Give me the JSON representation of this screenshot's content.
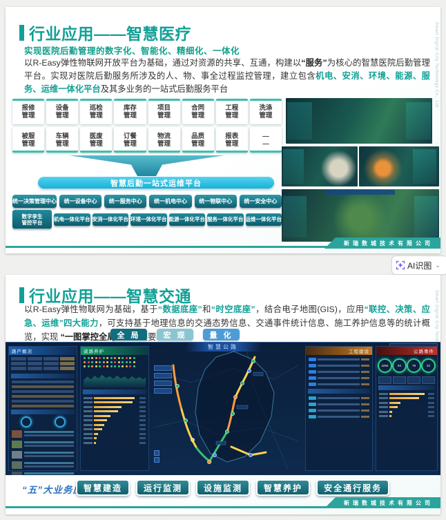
{
  "ai_button": {
    "label": "AI识图",
    "chevron": "⌄"
  },
  "slide1": {
    "title": "行业应用——智慧医疗",
    "side_text": "Smart Digital City Technology Co., Ltd",
    "subtitle": "实现医院后勤管理的数字化、智能化、精细化、一体化",
    "paragraph": [
      {
        "text": "以R-Easy弹性物联网开放平台为基础，通过对资源的共享、互通，构建以",
        "style": "n"
      },
      {
        "text": "“服务”",
        "style": "b"
      },
      {
        "text": "为核心的智慧医院后勤管理平台。实现对医院后勤服务所涉及的人、物、事全过程监控管理，建立包含",
        "style": "n"
      },
      {
        "text": "机电、安消、环境、能源、服务、运维一体化平台",
        "style": "t"
      },
      {
        "text": "及其多业务的一站式后勤服务平台",
        "style": "n"
      }
    ],
    "modules": [
      [
        [
          "报修",
          "管理"
        ],
        [
          "设备",
          "管理"
        ],
        [
          "巡检",
          "管理"
        ],
        [
          "库存",
          "管理"
        ],
        [
          "项目",
          "管理"
        ],
        [
          "合同",
          "管理"
        ],
        [
          "工程",
          "管理"
        ],
        [
          "洗涤",
          "管理"
        ]
      ],
      [
        [
          "被服",
          "管理"
        ],
        [
          "车辆",
          "管理"
        ],
        [
          "医废",
          "管理"
        ],
        [
          "订餐",
          "管理"
        ],
        [
          "物流",
          "管理"
        ],
        [
          "品质",
          "管理"
        ],
        [
          "报表",
          "管理"
        ],
        [
          "—",
          "—"
        ]
      ]
    ],
    "pipeline_bar": "智慧后勤一站式运维平台",
    "centers": [
      "统一决策管理中心",
      "统一设备中心",
      "统一服务中心",
      "统一机电中心",
      "统一物联中心",
      "统一安全中心"
    ],
    "platforms": [
      {
        "lines": [
          "数字孪生",
          "管控平台"
        ]
      },
      {
        "lines": [
          "机电一体化平台"
        ]
      },
      {
        "lines": [
          "安消一体化平台"
        ]
      },
      {
        "lines": [
          "环境一体化平台"
        ]
      },
      {
        "lines": [
          "能源一体化平台"
        ]
      },
      {
        "lines": [
          "服务一体化平台"
        ]
      },
      {
        "lines": [
          "运维一体化平台"
        ]
      }
    ],
    "company": "新瑞数城技术有限公司"
  },
  "slide2": {
    "title": "行业应用——智慧交通",
    "side_text": "Smart Digital City Technology Co., Ltd",
    "paragraph": [
      {
        "text": "以R-Easy弹性物联网为基础，基于",
        "style": "n"
      },
      {
        "text": "“数据底座”",
        "style": "t"
      },
      {
        "text": "和",
        "style": "n"
      },
      {
        "text": "“时空底座”",
        "style": "t"
      },
      {
        "text": "，结合电子地图(GIS)，应用",
        "style": "n"
      },
      {
        "text": "“联控、决策、应急、运维”四大能力",
        "style": "t"
      },
      {
        "text": "，可支持基于地理信息的交通态势信息、交通事件统计信息、施工养护信息等的统计概览，实现 ",
        "style": "n"
      },
      {
        "text": "“一图掌控全局”",
        "style": "b"
      },
      {
        "text": " 的管理要求。",
        "style": "n"
      }
    ],
    "mode_buttons": [
      {
        "label": "全 局",
        "color": "#116e80"
      },
      {
        "label": "宏 观",
        "color": "#8ac6d1"
      },
      {
        "label": "量 化",
        "color": "#4e9cd6"
      }
    ],
    "dashboard": {
      "banner": "智慧公路",
      "panel_titles": {
        "left": "路产概况",
        "maintenance": "道路养护",
        "construction": "工程建设",
        "events": "公路事件"
      },
      "gauge_values": [
        "4284",
        "94",
        "78",
        "22"
      ],
      "maintenance_bars": [
        92,
        88,
        62,
        55,
        38,
        30,
        24,
        18,
        10,
        7,
        5
      ],
      "event_bars": [
        95,
        80,
        30,
        22,
        8,
        5
      ]
    },
    "business_label": "“五”大业务应用",
    "business_buttons": [
      "智慧建造",
      "运行监测",
      "设施监测",
      "智慧养护",
      "安全通行服务"
    ],
    "company": "新瑞数城技术有限公司"
  }
}
